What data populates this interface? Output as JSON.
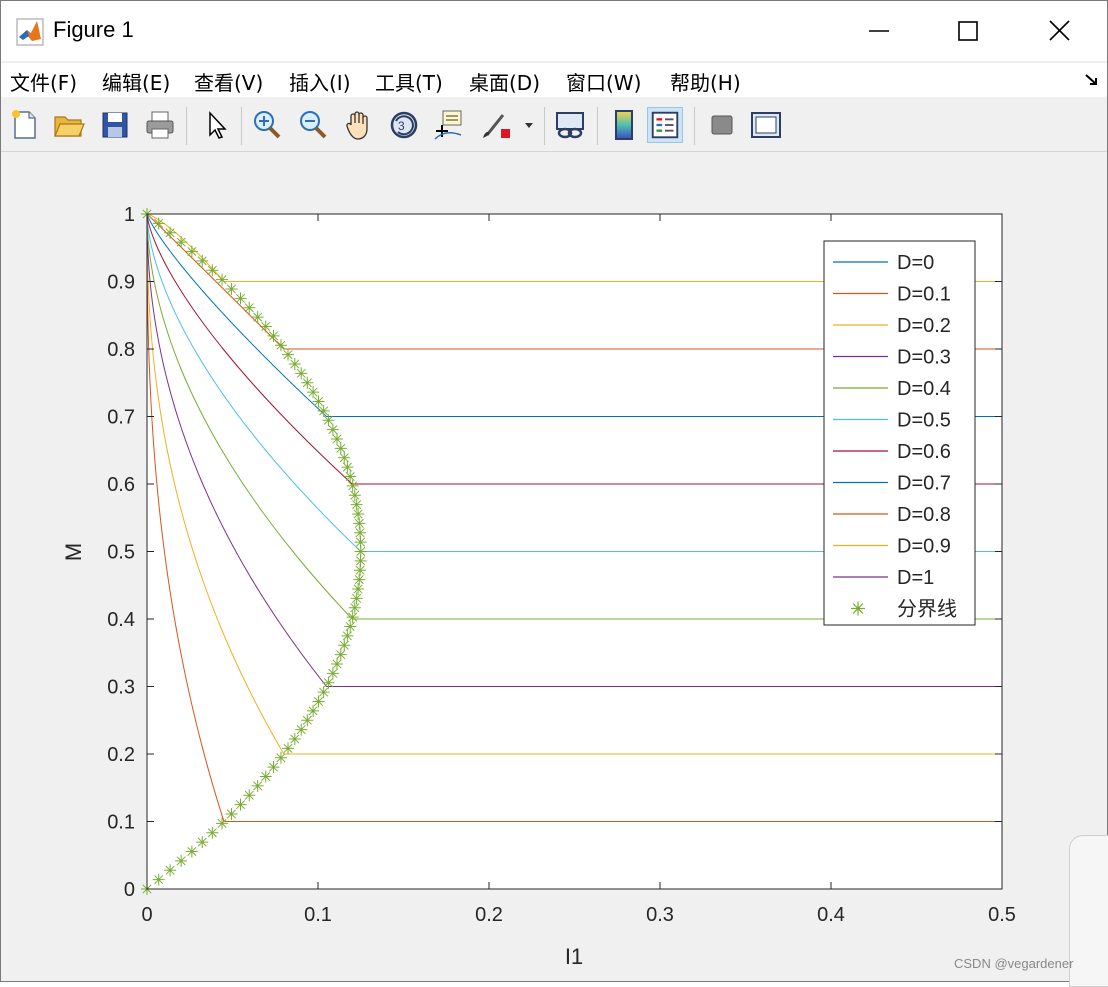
{
  "window": {
    "title": "Figure 1",
    "buttons": {
      "minimize": "minimize",
      "maximize": "maximize",
      "close": "close"
    }
  },
  "menu": [
    {
      "label": "文件(F)"
    },
    {
      "label": "编辑(E)"
    },
    {
      "label": "查看(V)"
    },
    {
      "label": "插入(I)"
    },
    {
      "label": "工具(T)"
    },
    {
      "label": "桌面(D)"
    },
    {
      "label": "窗口(W)"
    },
    {
      "label": "帮助(H)"
    }
  ],
  "toolbar": {
    "icons": [
      "new-file-icon",
      "open-folder-icon",
      "save-icon",
      "print-icon",
      "pointer-icon",
      "zoom-in-icon",
      "zoom-out-icon",
      "pan-hand-icon",
      "rotate-3d-icon",
      "data-cursor-icon",
      "brush-icon",
      "brush-dropdown-icon",
      "link-plot-icon",
      "colorbar-icon",
      "legend-icon",
      "hide-plot-tools-icon",
      "show-plot-tools-icon"
    ],
    "active": "legend-icon"
  },
  "watermark": "CSDN @vegardener",
  "chart_data": {
    "type": "line",
    "xlabel": "I1",
    "ylabel": "M",
    "xlim": [
      0,
      0.5
    ],
    "ylim": [
      0,
      1
    ],
    "xticks": [
      "0",
      "0.1",
      "0.2",
      "0.3",
      "0.4",
      "0.5"
    ],
    "yticks": [
      "0",
      "0.1",
      "0.2",
      "0.3",
      "0.4",
      "0.5",
      "0.6",
      "0.7",
      "0.8",
      "0.9",
      "1"
    ],
    "grid": false,
    "legend_position": "top-right",
    "colors": {
      "D0": "#0072bd",
      "D0.1": "#d95319",
      "D0.2": "#edb120",
      "D0.3": "#7e2f8e",
      "D0.4": "#77ac30",
      "D0.5": "#4dbeee",
      "D0.6": "#a2142f",
      "boundary": "#77ac30"
    },
    "series": [
      {
        "name": "D=0",
        "D": 0,
        "color": "#0072bd"
      },
      {
        "name": "D=0.1",
        "D": 0.1,
        "color": "#d95319"
      },
      {
        "name": "D=0.2",
        "D": 0.2,
        "color": "#edb120"
      },
      {
        "name": "D=0.3",
        "D": 0.3,
        "color": "#7e2f8e"
      },
      {
        "name": "D=0.4",
        "D": 0.4,
        "color": "#77ac30"
      },
      {
        "name": "D=0.5",
        "D": 0.5,
        "color": "#4dbeee"
      },
      {
        "name": "D=0.6",
        "D": 0.6,
        "color": "#a2142f"
      },
      {
        "name": "D=0.7",
        "D": 0.7,
        "color": "#0072bd"
      },
      {
        "name": "D=0.8",
        "D": 0.8,
        "color": "#d95319"
      },
      {
        "name": "D=0.9",
        "D": 0.9,
        "color": "#edb120"
      },
      {
        "name": "D=1",
        "D": 1.0,
        "color": "#7e2f8e"
      },
      {
        "name": "分界线",
        "marker": "asterisk",
        "color": "#77ac30"
      }
    ]
  }
}
